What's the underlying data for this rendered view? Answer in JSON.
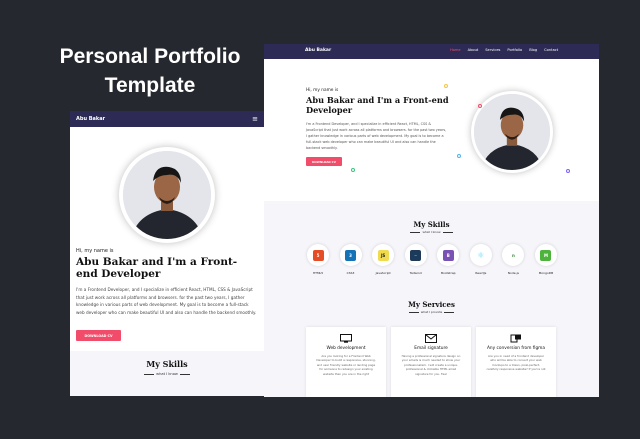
{
  "promo": {
    "title": "Personal Portfolio Template"
  },
  "mobile": {
    "brand": "Abu Bakar",
    "menu_icon": "hamburger-icon",
    "hi": "Hi, my name is",
    "headline": "Abu Bakar and I'm a Front-end Developer",
    "bio": "I'm a Frontend Developer, and I specialize in efficient React, HTML, CSS & JavaScript that just work across all platforms and browsers. for the past two years, I gather knowledge in various parts of web development. My goal is to become a full-stack web developer who can make beautiful UI and also can handle the backend smoothly.",
    "button": "DOWNLOAD CV",
    "skills_title": "My Skills",
    "skills_subtitle": "what I know"
  },
  "desktop": {
    "brand": "Abu Bakar",
    "nav": [
      "Home",
      "About",
      "Services",
      "Portfolio",
      "Blog",
      "Contact"
    ],
    "active_nav": "Home",
    "hi": "Hi, my name is",
    "headline": "Abu Bakar and I'm a Front-end Developer",
    "bio": "I'm a Frontend Developer, and I specialize in efficient React, HTML, CSS & JavaScript that just work across all platforms and browsers. for the past two years, I gather knowledge in various parts of web development. My goal is to become a full-stack web developer who can make beautiful UI and also can handle the backend smoothly.",
    "button": "DOWNLOAD CV",
    "skills_title": "My Skills",
    "skills_subtitle": "what I know",
    "skills": [
      {
        "label": "HTML5",
        "badge": "5",
        "color": "#e44d26"
      },
      {
        "label": "CSS3",
        "badge": "3",
        "color": "#1572b6"
      },
      {
        "label": "JavaScript",
        "badge": "JS",
        "color": "#f0db4f"
      },
      {
        "label": "Tailwind",
        "badge": "~",
        "color": "#38bdf8"
      },
      {
        "label": "Bootstrap",
        "badge": "B",
        "color": "#7952b3"
      },
      {
        "label": "ReactJs",
        "badge": "⚛",
        "color": "#61dafb"
      },
      {
        "label": "Node.js",
        "badge": "n",
        "color": "#3c873a"
      },
      {
        "label": "MongoDB",
        "badge": "M",
        "color": "#4db33d"
      }
    ],
    "services_title": "My Services",
    "services_subtitle": "what I provide",
    "services": [
      {
        "icon": "monitor-icon",
        "title": "Web development",
        "desc": "Are you looking for a Frontend Web Developer to build a responsive, stunning, and user friendly website or landing page for someone to redesign your existing website then you are in the right"
      },
      {
        "icon": "email-icon",
        "title": "Email signature",
        "desc": "Having a professional signature design on your emails is much needed to show your professionalism. I will create a unique, professional & clickable HTML email signature for you. Feel"
      },
      {
        "icon": "figma-icon",
        "title": "Any conversion from figma",
        "desc": "Are you in need of a frontend developer who will be able to convert your web mockups to a Clean, pixel-perfect, carefully responsive website? If you're not"
      }
    ],
    "accent": "#f14d6b",
    "nav_bg": "#2d2b55"
  }
}
